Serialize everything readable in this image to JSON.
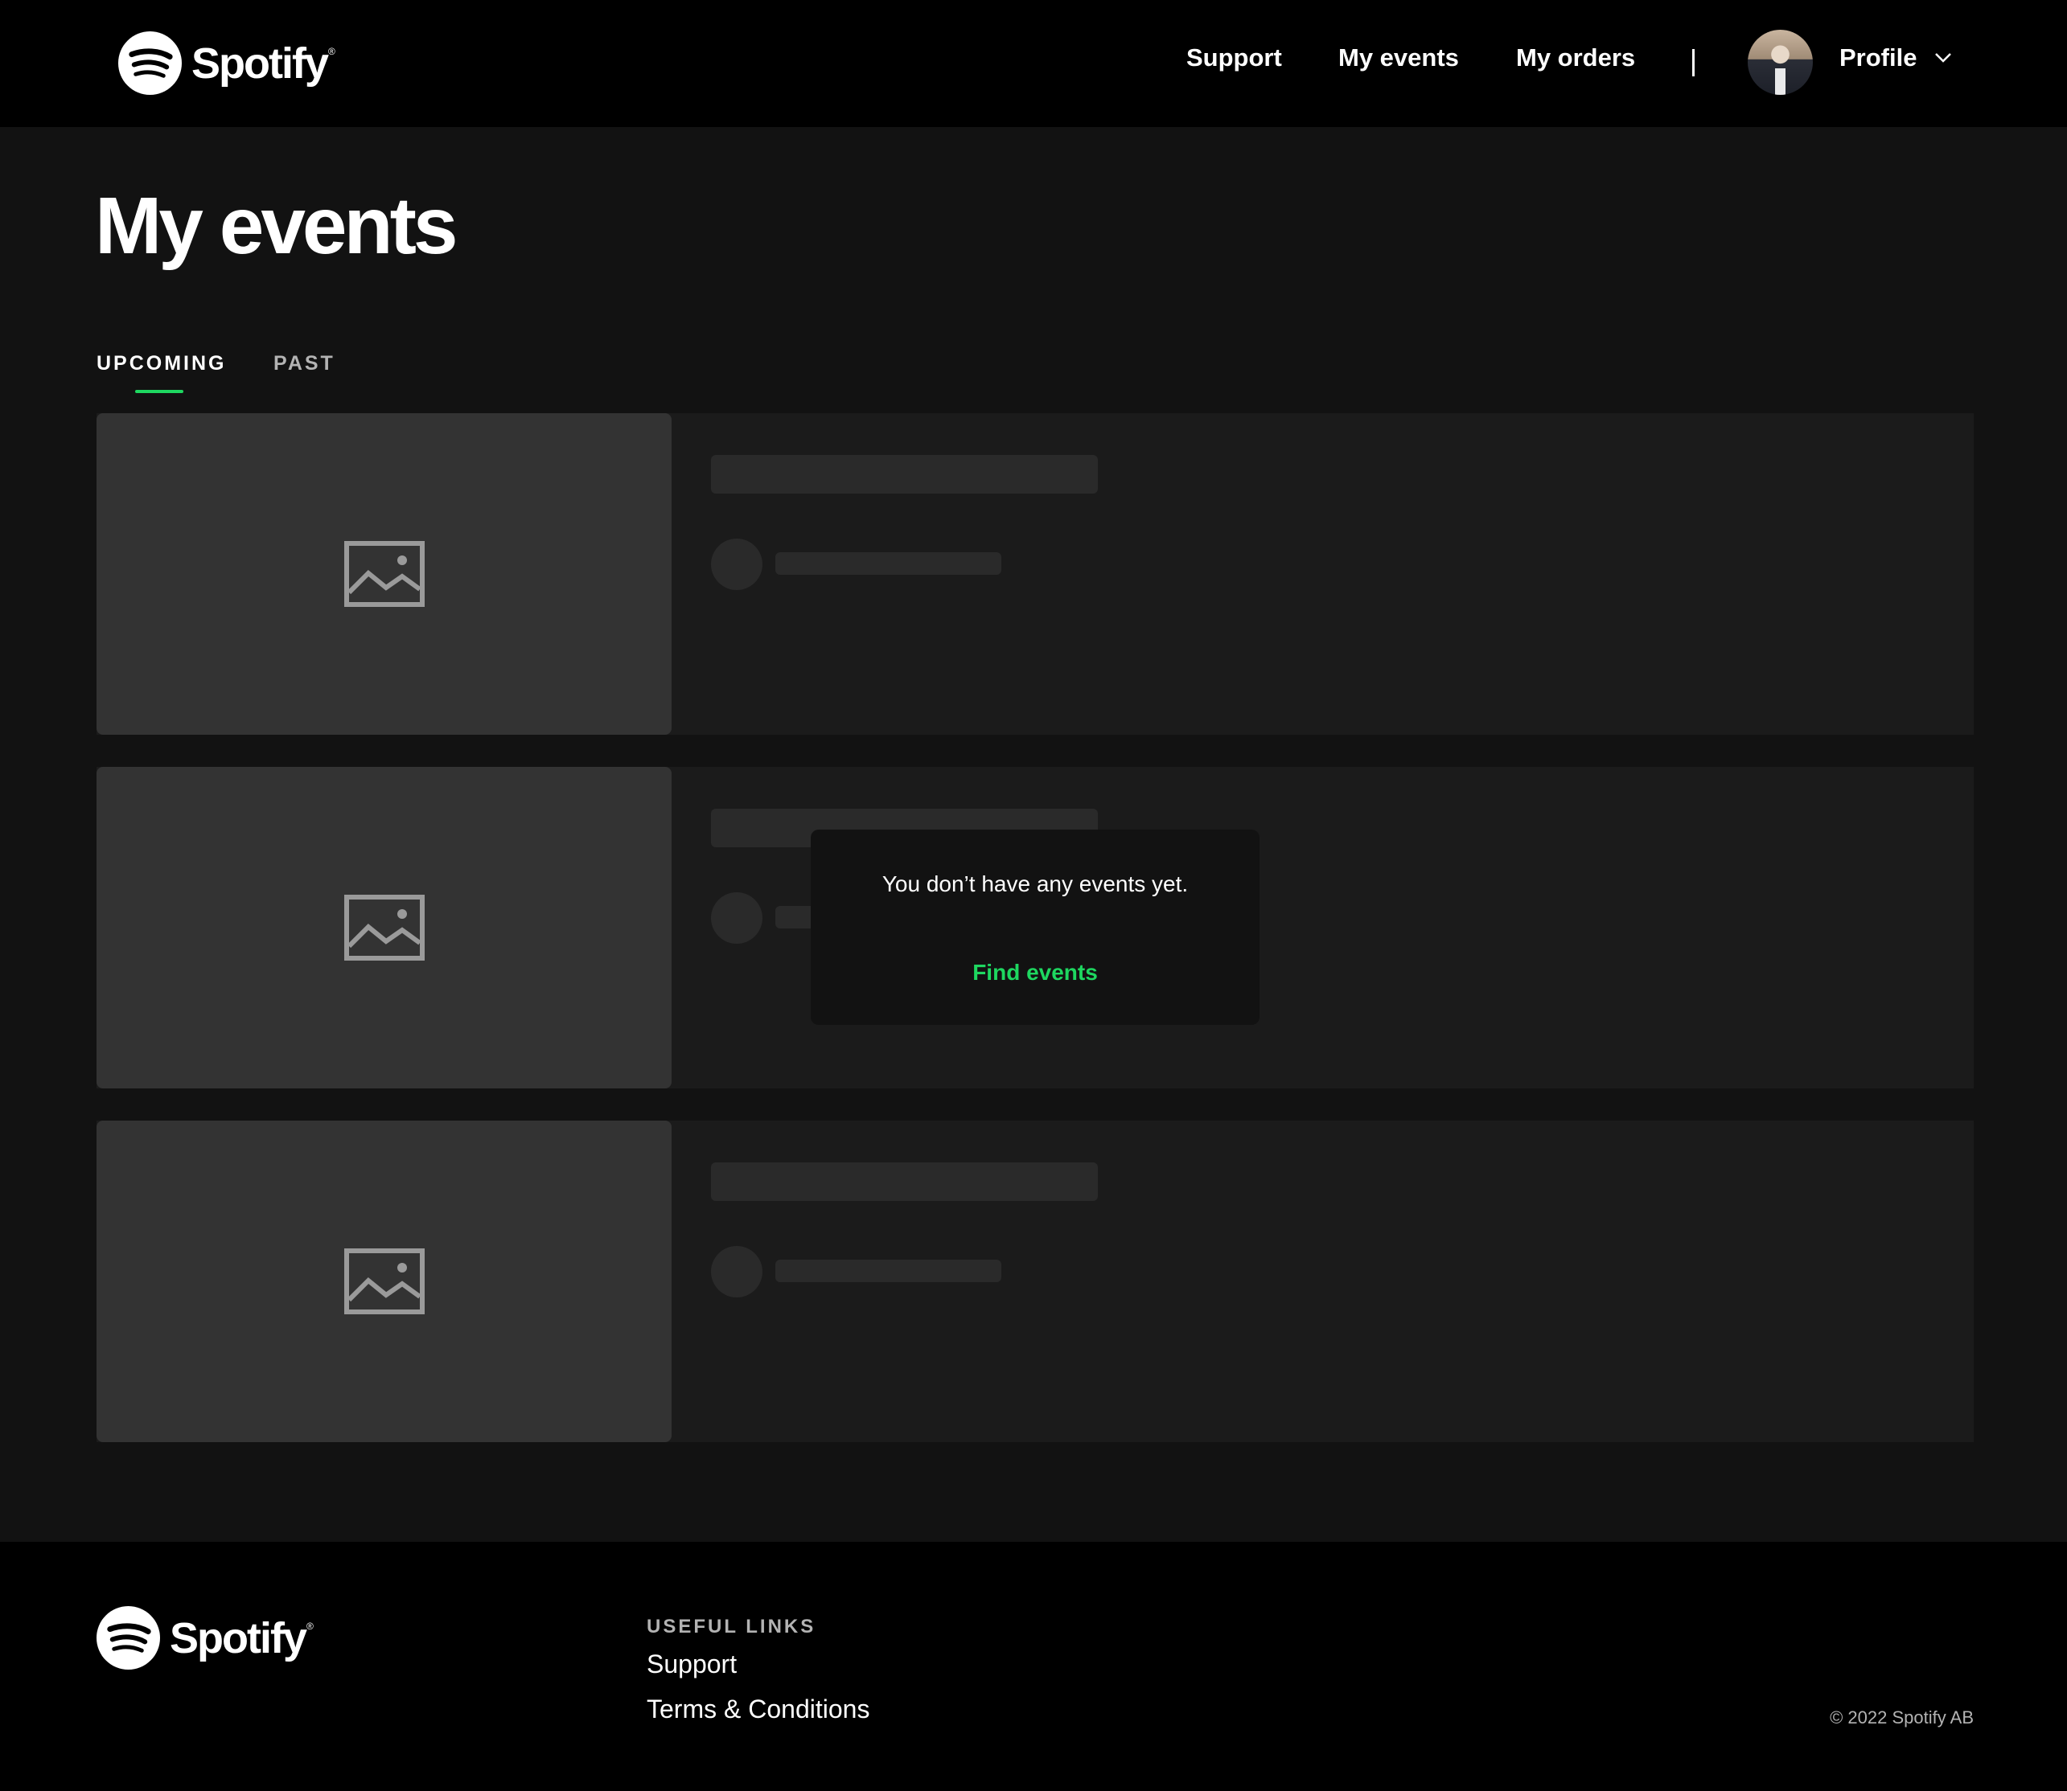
{
  "brand": {
    "name": "Spotify",
    "trademark": "®",
    "accent": "#1ed760"
  },
  "header": {
    "nav": {
      "support": "Support",
      "my_events": "My events",
      "my_orders": "My orders"
    },
    "profile_label": "Profile"
  },
  "page": {
    "title": "My events",
    "tabs": {
      "upcoming": "UPCOMING",
      "past": "PAST"
    },
    "active_tab": "UPCOMING"
  },
  "empty_state": {
    "message": "You don’t have any events yet.",
    "cta": "Find events"
  },
  "footer": {
    "useful_links_heading": "USEFUL LINKS",
    "links": {
      "support": "Support",
      "terms": "Terms & Conditions"
    },
    "copyright": "© 2022 Spotify AB"
  }
}
